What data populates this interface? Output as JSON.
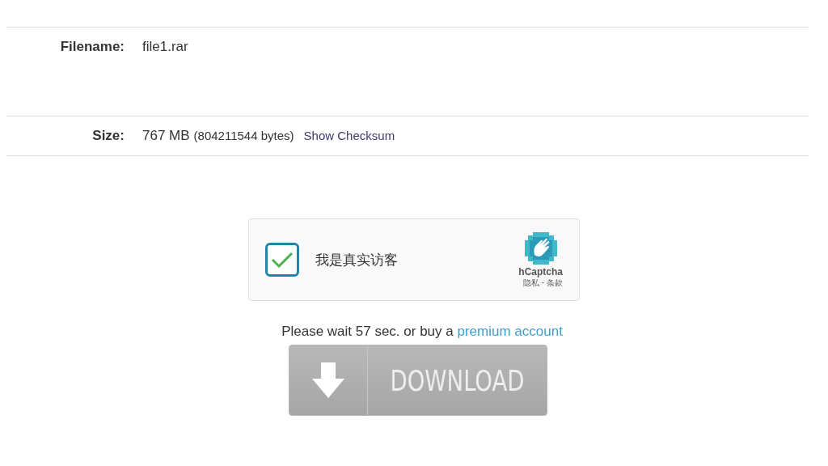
{
  "file_info": {
    "filename_label": "Filename:",
    "filename": "file1.rar",
    "size_label": "Size:",
    "size": "767 MB",
    "size_bytes": "(804211544 bytes)",
    "checksum_link": "Show Checksum"
  },
  "captcha": {
    "checked": true,
    "label": "我是真实访客",
    "brand": "hCaptcha",
    "privacy": "隐私",
    "separator": "-",
    "terms": "条款"
  },
  "wait_message": {
    "text": "Please wait 57 sec. or buy a",
    "link": "premium account"
  },
  "download_button": {
    "label": "DOWNLOAD",
    "disabled": true
  }
}
